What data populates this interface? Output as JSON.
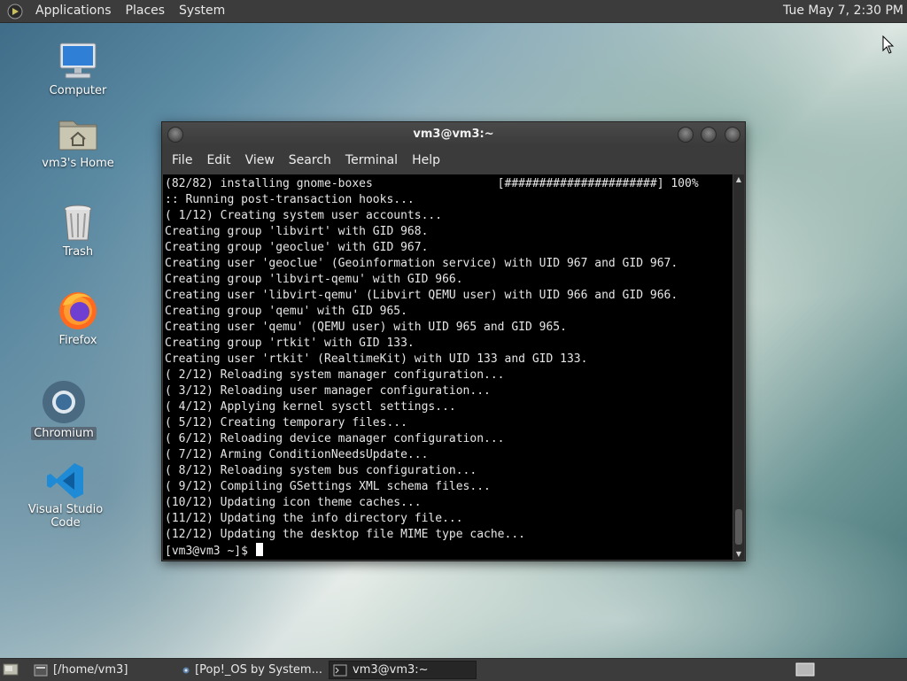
{
  "top_panel": {
    "menus": [
      "Applications",
      "Places",
      "System"
    ],
    "clock": "Tue May 7, 2:30 PM"
  },
  "desktop": {
    "icons": [
      {
        "label": "Computer",
        "icon": "computer-icon"
      },
      {
        "label": "vm3's Home",
        "icon": "home-folder-icon"
      },
      {
        "label": "Trash",
        "icon": "trash-icon"
      },
      {
        "label": "Firefox",
        "icon": "firefox-icon"
      },
      {
        "label": "Chromium",
        "icon": "chromium-icon",
        "selected": true
      },
      {
        "label": "Visual Studio Code",
        "icon": "vscode-icon"
      }
    ]
  },
  "terminal": {
    "title": "vm3@vm3:~",
    "menu": [
      "File",
      "Edit",
      "View",
      "Search",
      "Terminal",
      "Help"
    ],
    "lines": [
      "(82/82) installing gnome-boxes                  [######################] 100%",
      ":: Running post-transaction hooks...",
      "( 1/12) Creating system user accounts...",
      "Creating group 'libvirt' with GID 968.",
      "Creating group 'geoclue' with GID 967.",
      "Creating user 'geoclue' (Geoinformation service) with UID 967 and GID 967.",
      "Creating group 'libvirt-qemu' with GID 966.",
      "Creating user 'libvirt-qemu' (Libvirt QEMU user) with UID 966 and GID 966.",
      "Creating group 'qemu' with GID 965.",
      "Creating user 'qemu' (QEMU user) with UID 965 and GID 965.",
      "Creating group 'rtkit' with GID 133.",
      "Creating user 'rtkit' (RealtimeKit) with UID 133 and GID 133.",
      "( 2/12) Reloading system manager configuration...",
      "( 3/12) Reloading user manager configuration...",
      "( 4/12) Applying kernel sysctl settings...",
      "( 5/12) Creating temporary files...",
      "( 6/12) Reloading device manager configuration...",
      "( 7/12) Arming ConditionNeedsUpdate...",
      "( 8/12) Reloading system bus configuration...",
      "( 9/12) Compiling GSettings XML schema files...",
      "(10/12) Updating icon theme caches...",
      "(11/12) Updating the info directory file...",
      "(12/12) Updating the desktop file MIME type cache..."
    ],
    "prompt": "[vm3@vm3 ~]$ "
  },
  "taskbar": {
    "tasks": [
      {
        "label": "[/home/vm3]",
        "icon": "folder-window-icon",
        "active": false
      },
      {
        "label": "[Pop!_OS by System...",
        "icon": "chromium-window-icon",
        "active": false
      },
      {
        "label": "vm3@vm3:~",
        "icon": "terminal-window-icon",
        "active": true
      }
    ]
  }
}
